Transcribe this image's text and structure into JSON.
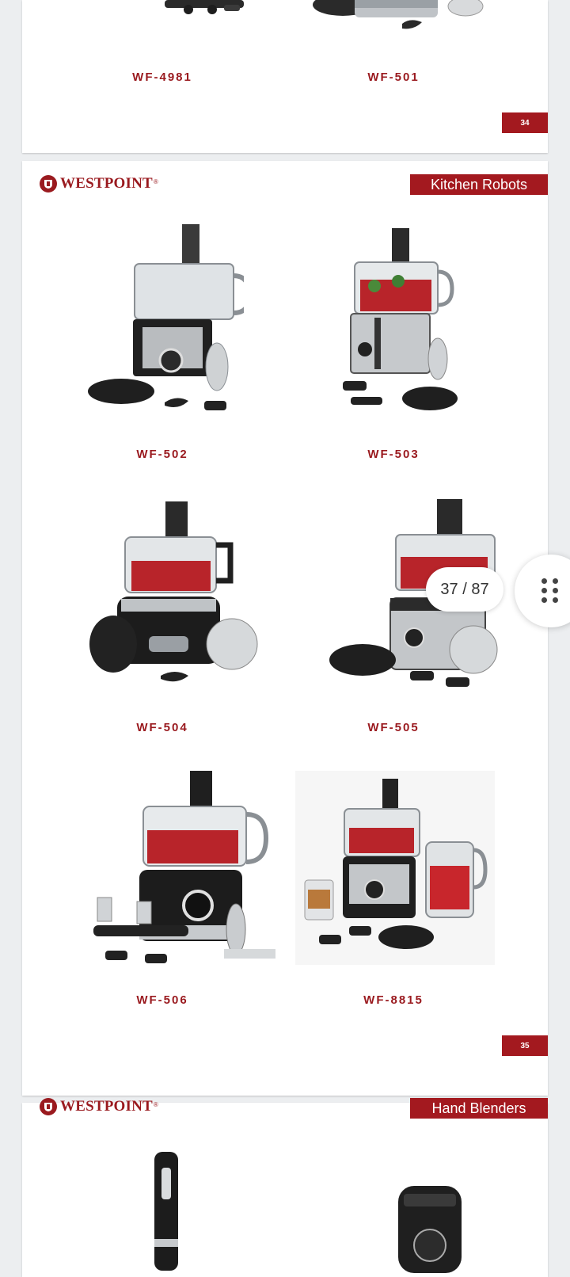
{
  "colors": {
    "brand_red": "#9a1a1f",
    "tag_red": "#a3191f",
    "background": "#eceef0"
  },
  "page1": {
    "models": [
      "WF-4981",
      "WF-501"
    ],
    "page_number": "34"
  },
  "page2": {
    "brand": "WESTPOINT",
    "brand_mark": "®",
    "section": "Kitchen Robots",
    "models": [
      "WF-502",
      "WF-503",
      "WF-504",
      "WF-505",
      "WF-506",
      "WF-8815"
    ],
    "page_number": "35"
  },
  "page3": {
    "brand": "WESTPOINT",
    "brand_mark": "®",
    "section": "Hand Blenders"
  },
  "viewer": {
    "page_counter": "37 / 87",
    "menu_icon": "grid-dots-icon"
  }
}
